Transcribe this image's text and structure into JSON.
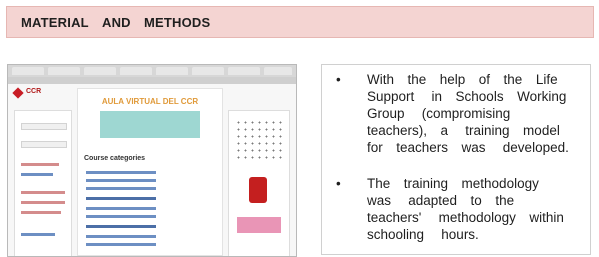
{
  "title": "MATERIAL AND METHODS ",
  "screenshot": {
    "center_title": "AULA VIRTUAL DEL CCR",
    "center_section": "Course categories",
    "logo_text": "CCR"
  },
  "bullets": [
    {
      "text": "With the help of the Life Support  in Schools Working Group  (compromising teachers), a  training model for teachers was  developed. "
    },
    {
      "text": "The training methodology was  adapted to the teachers'  methodology within schooling  hours.  "
    }
  ]
}
